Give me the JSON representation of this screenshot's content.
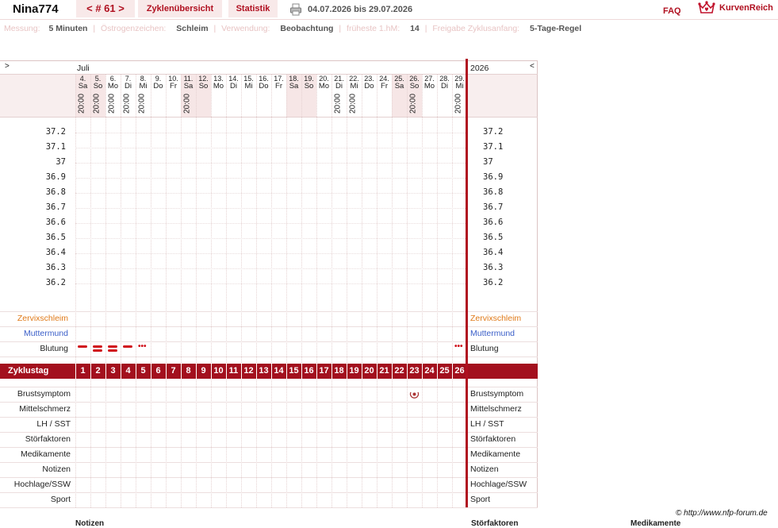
{
  "header": {
    "user": "Nina774",
    "cycle_nav": "< # 61 >",
    "tabs": [
      "Zyklenübersicht",
      "Statistik"
    ],
    "date_range": "04.07.2026 bis 29.07.2026",
    "faq": "FAQ",
    "brand": "KurvenReich",
    "print_icon": "printer-icon",
    "logo_icon": "crown-heart-icon"
  },
  "info": [
    {
      "label": "Messung:",
      "value": "5 Minuten"
    },
    {
      "label": "Östrogenzeichen:",
      "value": "Schleim"
    },
    {
      "label": "Verwendung:",
      "value": "Beobachtung"
    },
    {
      "label": "früheste 1.hM:",
      "value": "14"
    },
    {
      "label": "Freigabe Zyklusanfang:",
      "value": "5-Tage-Regel"
    }
  ],
  "chart": {
    "nav_left": ">",
    "nav_right": "<",
    "month": "Juli",
    "year": "2026",
    "days": [
      {
        "num": "4.",
        "wd": "Sa",
        "time": "20:00",
        "weekend": true
      },
      {
        "num": "5.",
        "wd": "So",
        "time": "20:00",
        "weekend": true
      },
      {
        "num": "6.",
        "wd": "Mo",
        "time": "20:00",
        "weekend": false
      },
      {
        "num": "7.",
        "wd": "Di",
        "time": "20:00",
        "weekend": false
      },
      {
        "num": "8.",
        "wd": "Mi",
        "time": "20:00",
        "weekend": false
      },
      {
        "num": "9.",
        "wd": "Do",
        "time": "",
        "weekend": false
      },
      {
        "num": "10.",
        "wd": "Fr",
        "time": "",
        "weekend": false
      },
      {
        "num": "11.",
        "wd": "Sa",
        "time": "20:00",
        "weekend": true
      },
      {
        "num": "12.",
        "wd": "So",
        "time": "",
        "weekend": true
      },
      {
        "num": "13.",
        "wd": "Mo",
        "time": "",
        "weekend": false
      },
      {
        "num": "14.",
        "wd": "Di",
        "time": "",
        "weekend": false
      },
      {
        "num": "15.",
        "wd": "Mi",
        "time": "",
        "weekend": false
      },
      {
        "num": "16.",
        "wd": "Do",
        "time": "",
        "weekend": false
      },
      {
        "num": "17.",
        "wd": "Fr",
        "time": "",
        "weekend": false
      },
      {
        "num": "18.",
        "wd": "Sa",
        "time": "",
        "weekend": true
      },
      {
        "num": "19.",
        "wd": "So",
        "time": "",
        "weekend": true
      },
      {
        "num": "20.",
        "wd": "Mo",
        "time": "",
        "weekend": false
      },
      {
        "num": "21.",
        "wd": "Di",
        "time": "20:00",
        "weekend": false
      },
      {
        "num": "22.",
        "wd": "Mi",
        "time": "20:00",
        "weekend": false
      },
      {
        "num": "23.",
        "wd": "Do",
        "time": "",
        "weekend": false
      },
      {
        "num": "24.",
        "wd": "Fr",
        "time": "",
        "weekend": false
      },
      {
        "num": "25.",
        "wd": "Sa",
        "time": "",
        "weekend": true
      },
      {
        "num": "26.",
        "wd": "So",
        "time": "20:00",
        "weekend": true
      },
      {
        "num": "27.",
        "wd": "Mo",
        "time": "",
        "weekend": false
      },
      {
        "num": "28.",
        "wd": "Di",
        "time": "",
        "weekend": false
      },
      {
        "num": "29.",
        "wd": "Mi",
        "time": "20:00",
        "weekend": false
      }
    ],
    "temperature_ticks": [
      "37.2",
      "37.1",
      "37",
      "36.9",
      "36.8",
      "36.7",
      "36.6",
      "36.5",
      "36.4",
      "36.3",
      "36.2"
    ],
    "temperature_values": [],
    "rows_top": [
      {
        "label": "Zervixschleim",
        "color": "#e07a1a"
      },
      {
        "label": "Muttermund",
        "color": "#3a5ec8"
      },
      {
        "label": "Blutung",
        "color": "#222222"
      }
    ],
    "bleeding": [
      {
        "day": 1,
        "type": "dash-single"
      },
      {
        "day": 2,
        "type": "dash-double"
      },
      {
        "day": 3,
        "type": "dash-double"
      },
      {
        "day": 4,
        "type": "dash-single"
      },
      {
        "day": 5,
        "type": "dots"
      },
      {
        "day": 26,
        "type": "dots"
      }
    ],
    "cycle_label": "Zyklustag",
    "cycle_days": [
      "1",
      "2",
      "3",
      "4",
      "5",
      "6",
      "7",
      "8",
      "9",
      "10",
      "11",
      "12",
      "13",
      "14",
      "15",
      "16",
      "17",
      "18",
      "19",
      "20",
      "21",
      "22",
      "23",
      "24",
      "25",
      "26"
    ],
    "rows_bottom": [
      "Brustsymptom",
      "Mittelschmerz",
      "LH / SST",
      "Störfaktoren",
      "Medikamente",
      "Notizen",
      "Hochlage/SSW",
      "Sport"
    ],
    "breast_symptom_day": 23,
    "accent_color": "#b01020",
    "cycle_bar_color": "#a3101e"
  },
  "footer": {
    "copyright": "© http://www.nfp-forum.de",
    "cut_labels": [
      "Notizen",
      "Störfaktoren",
      "Medikamente"
    ]
  }
}
